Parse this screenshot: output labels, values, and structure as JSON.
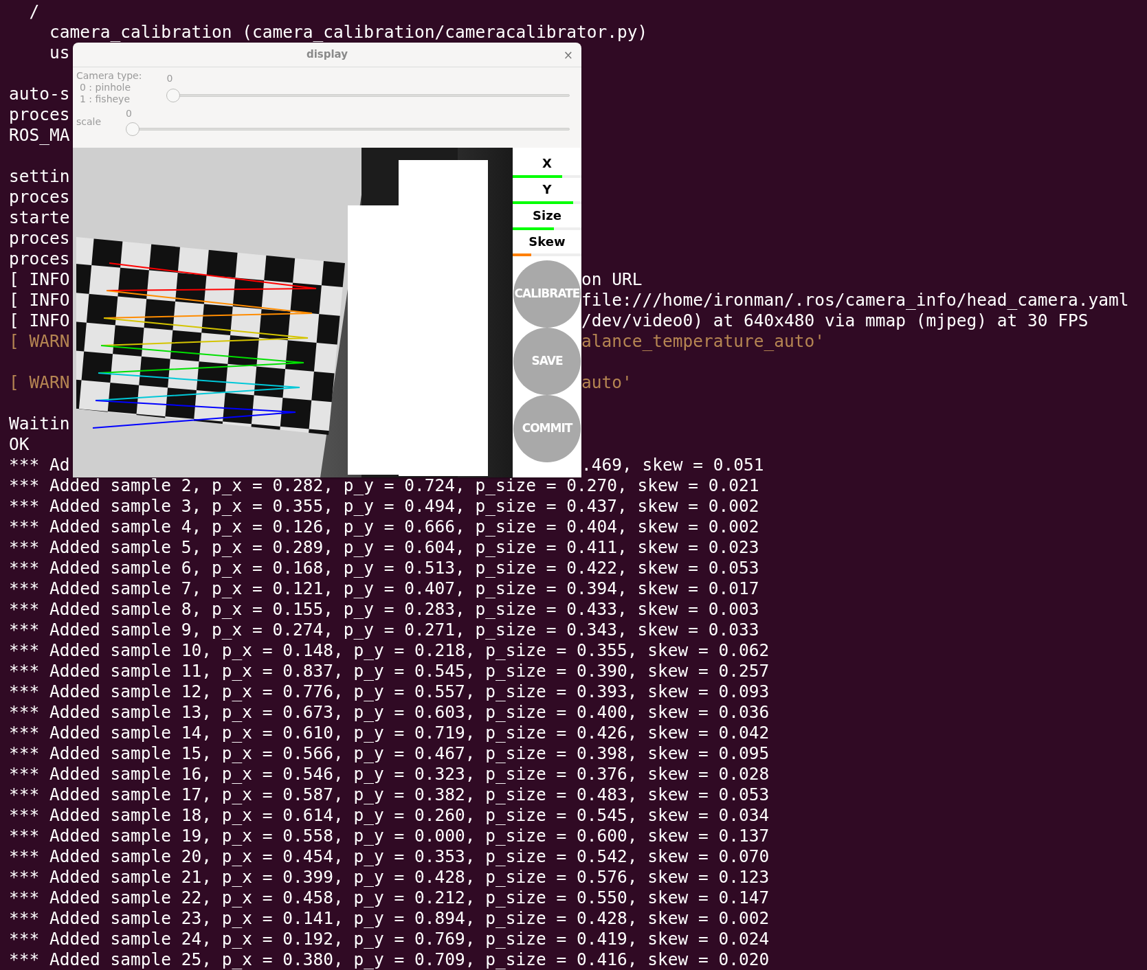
{
  "terminal": {
    "lines": [
      {
        "kind": "plain",
        "text": "  /"
      },
      {
        "kind": "plain",
        "text": "    camera_calibration (camera_calibration/cameracalibrator.py)"
      },
      {
        "kind": "plain",
        "text": "    us"
      },
      {
        "kind": "blank"
      },
      {
        "kind": "plain",
        "text": "auto-s"
      },
      {
        "kind": "plain",
        "text": "proces"
      },
      {
        "kind": "plain",
        "text": "ROS_MA"
      },
      {
        "kind": "blank"
      },
      {
        "kind": "plain",
        "text": "settin"
      },
      {
        "kind": "plain",
        "text": "proces"
      },
      {
        "kind": "plain",
        "text": "starte"
      },
      {
        "kind": "plain",
        "text": "proces"
      },
      {
        "kind": "plain",
        "text": "proces"
      },
      {
        "kind": "plain",
        "text": "[ INFO",
        "right": "on URL"
      },
      {
        "kind": "plain",
        "text": "[ INFO",
        "right": "file:///home/ironman/.ros/camera_info/head_camera.yaml"
      },
      {
        "kind": "plain",
        "text": "[ INFO",
        "right": "/dev/video0) at 640x480 via mmap (mjpeg) at 30 FPS"
      },
      {
        "kind": "warn",
        "text": "[ WARN",
        "right": "alance_temperature_auto'"
      },
      {
        "kind": "blank"
      },
      {
        "kind": "warn",
        "text": "[ WARN",
        "right": "auto'"
      },
      {
        "kind": "blank"
      },
      {
        "kind": "plain",
        "text": "Waitin"
      },
      {
        "kind": "plain",
        "text": "OK"
      },
      {
        "kind": "plain",
        "text": "*** Ad",
        "right": ".469, skew = 0.051"
      },
      {
        "kind": "plain",
        "text": "*** Added sample 2, p_x = 0.282, p_y = 0.724, p_size = 0.270, skew = 0.021"
      },
      {
        "kind": "plain",
        "text": "*** Added sample 3, p_x = 0.355, p_y = 0.494, p_size = 0.437, skew = 0.002"
      },
      {
        "kind": "plain",
        "text": "*** Added sample 4, p_x = 0.126, p_y = 0.666, p_size = 0.404, skew = 0.002"
      },
      {
        "kind": "plain",
        "text": "*** Added sample 5, p_x = 0.289, p_y = 0.604, p_size = 0.411, skew = 0.023"
      },
      {
        "kind": "plain",
        "text": "*** Added sample 6, p_x = 0.168, p_y = 0.513, p_size = 0.422, skew = 0.053"
      },
      {
        "kind": "plain",
        "text": "*** Added sample 7, p_x = 0.121, p_y = 0.407, p_size = 0.394, skew = 0.017"
      },
      {
        "kind": "plain",
        "text": "*** Added sample 8, p_x = 0.155, p_y = 0.283, p_size = 0.433, skew = 0.003"
      },
      {
        "kind": "plain",
        "text": "*** Added sample 9, p_x = 0.274, p_y = 0.271, p_size = 0.343, skew = 0.033"
      },
      {
        "kind": "plain",
        "text": "*** Added sample 10, p_x = 0.148, p_y = 0.218, p_size = 0.355, skew = 0.062"
      },
      {
        "kind": "plain",
        "text": "*** Added sample 11, p_x = 0.837, p_y = 0.545, p_size = 0.390, skew = 0.257"
      },
      {
        "kind": "plain",
        "text": "*** Added sample 12, p_x = 0.776, p_y = 0.557, p_size = 0.393, skew = 0.093"
      },
      {
        "kind": "plain",
        "text": "*** Added sample 13, p_x = 0.673, p_y = 0.603, p_size = 0.400, skew = 0.036"
      },
      {
        "kind": "plain",
        "text": "*** Added sample 14, p_x = 0.610, p_y = 0.719, p_size = 0.426, skew = 0.042"
      },
      {
        "kind": "plain",
        "text": "*** Added sample 15, p_x = 0.566, p_y = 0.467, p_size = 0.398, skew = 0.095"
      },
      {
        "kind": "plain",
        "text": "*** Added sample 16, p_x = 0.546, p_y = 0.323, p_size = 0.376, skew = 0.028"
      },
      {
        "kind": "plain",
        "text": "*** Added sample 17, p_x = 0.587, p_y = 0.382, p_size = 0.483, skew = 0.053"
      },
      {
        "kind": "plain",
        "text": "*** Added sample 18, p_x = 0.614, p_y = 0.260, p_size = 0.545, skew = 0.034"
      },
      {
        "kind": "plain",
        "text": "*** Added sample 19, p_x = 0.558, p_y = 0.000, p_size = 0.600, skew = 0.137"
      },
      {
        "kind": "plain",
        "text": "*** Added sample 20, p_x = 0.454, p_y = 0.353, p_size = 0.542, skew = 0.070"
      },
      {
        "kind": "plain",
        "text": "*** Added sample 21, p_x = 0.399, p_y = 0.428, p_size = 0.576, skew = 0.123"
      },
      {
        "kind": "plain",
        "text": "*** Added sample 22, p_x = 0.458, p_y = 0.212, p_size = 0.550, skew = 0.147"
      },
      {
        "kind": "plain",
        "text": "*** Added sample 23, p_x = 0.141, p_y = 0.894, p_size = 0.428, skew = 0.002"
      },
      {
        "kind": "plain",
        "text": "*** Added sample 24, p_x = 0.192, p_y = 0.769, p_size = 0.419, skew = 0.024"
      },
      {
        "kind": "plain",
        "text": "*** Added sample 25, p_x = 0.380, p_y = 0.709, p_size = 0.416, skew = 0.020"
      }
    ]
  },
  "display_window": {
    "title": "display",
    "close": "×",
    "trackbars": [
      {
        "label": "Camera type:",
        "options": [
          "0 : pinhole",
          "1 : fisheye"
        ],
        "value": "0",
        "level": 0
      },
      {
        "label": "scale",
        "value": "0",
        "level": 0
      }
    ],
    "progress": [
      {
        "label": "X",
        "level": 0.72,
        "color": "#00ff00"
      },
      {
        "label": "Y",
        "level": 0.88,
        "color": "#00ff00"
      },
      {
        "label": "Size",
        "level": 0.6,
        "color": "#00ff00"
      },
      {
        "label": "Skew",
        "level": 0.27,
        "color": "#ff8000"
      }
    ],
    "buttons": [
      {
        "label": "CALIBRATE",
        "disabled": true
      },
      {
        "label": "SAVE",
        "disabled": true
      },
      {
        "label": "COMMIT",
        "disabled": true
      }
    ]
  }
}
